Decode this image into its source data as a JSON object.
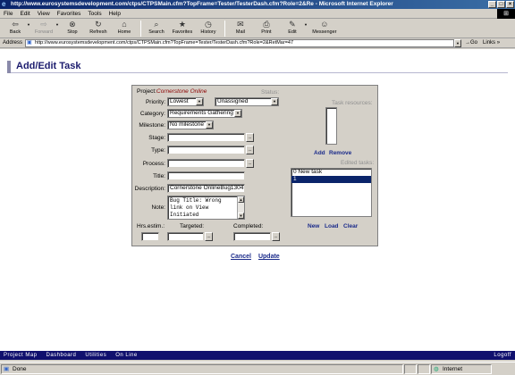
{
  "window": {
    "title": "http://www.eurosystemsdevelopment.com/ctps/CTPSMain.cfm?TopFrame=Tester/TesterDash.cfm?Role=2&Re - Microsoft Internet Explorer",
    "minimize": "_",
    "maximize": "□",
    "close": "×"
  },
  "menu": [
    "File",
    "Edit",
    "View",
    "Favorites",
    "Tools",
    "Help"
  ],
  "toolbar": {
    "back": "Back",
    "forward": "Forward",
    "stop": "Stop",
    "refresh": "Refresh",
    "home": "Home",
    "search": "Search",
    "favorites": "Favorites",
    "history": "History",
    "mail": "Mail",
    "print": "Print",
    "edit": "Edit",
    "messenger": "Messenger"
  },
  "address": {
    "label": "Address",
    "url": "http://www.eurosystemsdevelopment.com/ctps/CTPSMain.cfm?TopFrame=Tester/TesterDash.cfm?Role=2&RetMar=47",
    "go": "Go",
    "links": "Links"
  },
  "page": {
    "title": "Add/Edit Task"
  },
  "form": {
    "project_label": "Project:",
    "project_value": "Cornerstone Online",
    "status_label": "Status:",
    "priority_label": "Priority:",
    "priority_value": "Lowest",
    "assignee_value": "Unassigned",
    "category_label": "Category:",
    "category_value": "Requirements Gathering",
    "milestone_label": "Milestone:",
    "milestone_value": "No milestone",
    "stage_label": "Stage:",
    "type_label": "Type:",
    "process_label": "Process:",
    "title_label": "Title:",
    "description_label": "Description:",
    "description_value": "Cornerstone OnlineBug1304",
    "note_label": "Note:",
    "note_lines": [
      "Bug Title: Wrong",
      "link on View",
      "Initiated"
    ],
    "hrs_label": "Hrs.estim.:",
    "targeted_label": "Targeted:",
    "completed_label": "Completed:",
    "task_resources_label": "Task resources:",
    "add": "Add",
    "remove": "Remove",
    "edited_tasks_label": "Edited tasks:",
    "edited_tasks": [
      "0 New task",
      "1"
    ],
    "new": "New",
    "load": "Load",
    "clear": "Clear",
    "ellipsis": "..."
  },
  "actions": {
    "cancel": "Cancel",
    "update": "Update"
  },
  "footer": {
    "items": [
      "Project Map",
      "Dashboard",
      "Utilities",
      "On Line"
    ],
    "logoff": "Logoff"
  },
  "status": {
    "text": "Done",
    "zone": "Internet"
  }
}
